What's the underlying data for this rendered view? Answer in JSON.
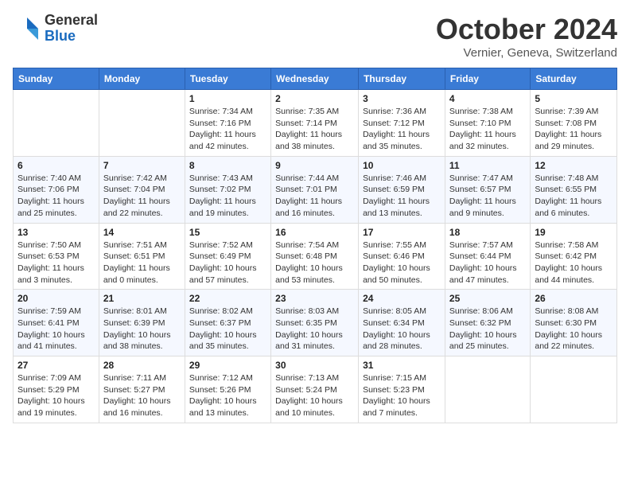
{
  "header": {
    "logo": {
      "general": "General",
      "blue": "Blue"
    },
    "title": "October 2024",
    "location": "Vernier, Geneva, Switzerland"
  },
  "days_of_week": [
    "Sunday",
    "Monday",
    "Tuesday",
    "Wednesday",
    "Thursday",
    "Friday",
    "Saturday"
  ],
  "weeks": [
    [
      {
        "day": "",
        "info": ""
      },
      {
        "day": "",
        "info": ""
      },
      {
        "day": "1",
        "info": "Sunrise: 7:34 AM\nSunset: 7:16 PM\nDaylight: 11 hours and 42 minutes."
      },
      {
        "day": "2",
        "info": "Sunrise: 7:35 AM\nSunset: 7:14 PM\nDaylight: 11 hours and 38 minutes."
      },
      {
        "day": "3",
        "info": "Sunrise: 7:36 AM\nSunset: 7:12 PM\nDaylight: 11 hours and 35 minutes."
      },
      {
        "day": "4",
        "info": "Sunrise: 7:38 AM\nSunset: 7:10 PM\nDaylight: 11 hours and 32 minutes."
      },
      {
        "day": "5",
        "info": "Sunrise: 7:39 AM\nSunset: 7:08 PM\nDaylight: 11 hours and 29 minutes."
      }
    ],
    [
      {
        "day": "6",
        "info": "Sunrise: 7:40 AM\nSunset: 7:06 PM\nDaylight: 11 hours and 25 minutes."
      },
      {
        "day": "7",
        "info": "Sunrise: 7:42 AM\nSunset: 7:04 PM\nDaylight: 11 hours and 22 minutes."
      },
      {
        "day": "8",
        "info": "Sunrise: 7:43 AM\nSunset: 7:02 PM\nDaylight: 11 hours and 19 minutes."
      },
      {
        "day": "9",
        "info": "Sunrise: 7:44 AM\nSunset: 7:01 PM\nDaylight: 11 hours and 16 minutes."
      },
      {
        "day": "10",
        "info": "Sunrise: 7:46 AM\nSunset: 6:59 PM\nDaylight: 11 hours and 13 minutes."
      },
      {
        "day": "11",
        "info": "Sunrise: 7:47 AM\nSunset: 6:57 PM\nDaylight: 11 hours and 9 minutes."
      },
      {
        "day": "12",
        "info": "Sunrise: 7:48 AM\nSunset: 6:55 PM\nDaylight: 11 hours and 6 minutes."
      }
    ],
    [
      {
        "day": "13",
        "info": "Sunrise: 7:50 AM\nSunset: 6:53 PM\nDaylight: 11 hours and 3 minutes."
      },
      {
        "day": "14",
        "info": "Sunrise: 7:51 AM\nSunset: 6:51 PM\nDaylight: 11 hours and 0 minutes."
      },
      {
        "day": "15",
        "info": "Sunrise: 7:52 AM\nSunset: 6:49 PM\nDaylight: 10 hours and 57 minutes."
      },
      {
        "day": "16",
        "info": "Sunrise: 7:54 AM\nSunset: 6:48 PM\nDaylight: 10 hours and 53 minutes."
      },
      {
        "day": "17",
        "info": "Sunrise: 7:55 AM\nSunset: 6:46 PM\nDaylight: 10 hours and 50 minutes."
      },
      {
        "day": "18",
        "info": "Sunrise: 7:57 AM\nSunset: 6:44 PM\nDaylight: 10 hours and 47 minutes."
      },
      {
        "day": "19",
        "info": "Sunrise: 7:58 AM\nSunset: 6:42 PM\nDaylight: 10 hours and 44 minutes."
      }
    ],
    [
      {
        "day": "20",
        "info": "Sunrise: 7:59 AM\nSunset: 6:41 PM\nDaylight: 10 hours and 41 minutes."
      },
      {
        "day": "21",
        "info": "Sunrise: 8:01 AM\nSunset: 6:39 PM\nDaylight: 10 hours and 38 minutes."
      },
      {
        "day": "22",
        "info": "Sunrise: 8:02 AM\nSunset: 6:37 PM\nDaylight: 10 hours and 35 minutes."
      },
      {
        "day": "23",
        "info": "Sunrise: 8:03 AM\nSunset: 6:35 PM\nDaylight: 10 hours and 31 minutes."
      },
      {
        "day": "24",
        "info": "Sunrise: 8:05 AM\nSunset: 6:34 PM\nDaylight: 10 hours and 28 minutes."
      },
      {
        "day": "25",
        "info": "Sunrise: 8:06 AM\nSunset: 6:32 PM\nDaylight: 10 hours and 25 minutes."
      },
      {
        "day": "26",
        "info": "Sunrise: 8:08 AM\nSunset: 6:30 PM\nDaylight: 10 hours and 22 minutes."
      }
    ],
    [
      {
        "day": "27",
        "info": "Sunrise: 7:09 AM\nSunset: 5:29 PM\nDaylight: 10 hours and 19 minutes."
      },
      {
        "day": "28",
        "info": "Sunrise: 7:11 AM\nSunset: 5:27 PM\nDaylight: 10 hours and 16 minutes."
      },
      {
        "day": "29",
        "info": "Sunrise: 7:12 AM\nSunset: 5:26 PM\nDaylight: 10 hours and 13 minutes."
      },
      {
        "day": "30",
        "info": "Sunrise: 7:13 AM\nSunset: 5:24 PM\nDaylight: 10 hours and 10 minutes."
      },
      {
        "day": "31",
        "info": "Sunrise: 7:15 AM\nSunset: 5:23 PM\nDaylight: 10 hours and 7 minutes."
      },
      {
        "day": "",
        "info": ""
      },
      {
        "day": "",
        "info": ""
      }
    ]
  ]
}
